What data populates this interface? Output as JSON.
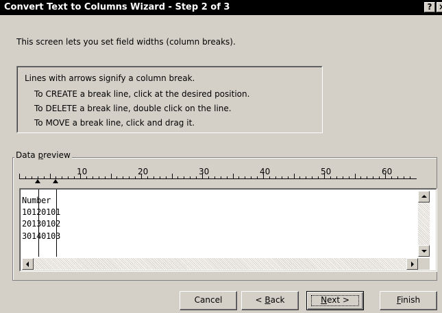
{
  "window": {
    "title": "Convert Text to Columns Wizard - Step 2 of 3",
    "help_glyph": "?",
    "close_glyph": "×"
  },
  "intro": "This screen lets you set field widths (column breaks).",
  "info": {
    "heading": "Lines with arrows signify a column break.",
    "create": "To CREATE a break line, click at the desired position.",
    "delete": "To DELETE a break line, double click on the line.",
    "move": "To MOVE a break line, click and drag it."
  },
  "preview": {
    "group_label_pre": "Data ",
    "group_label_u": "p",
    "group_label_post": "review",
    "ruler_numbers": [
      "10",
      "20",
      "30",
      "40",
      "50",
      "60"
    ],
    "rows": [
      "Number",
      "10120101",
      "20130102",
      "30140103"
    ]
  },
  "buttons": {
    "cancel": "Cancel",
    "back_pre": "< ",
    "back_u": "B",
    "back_post": "ack",
    "next_u": "N",
    "next_post": "ext >",
    "finish_u": "F",
    "finish_post": "inish"
  },
  "icons": {
    "help": "help-icon",
    "close": "close-icon",
    "scroll_up": "arrow-up-icon",
    "scroll_down": "arrow-down-icon",
    "scroll_left": "arrow-left-icon",
    "scroll_right": "arrow-right-icon",
    "break_arrow": "up-arrow-icon"
  },
  "colors": {
    "dialog_bg": "#d4d0c8",
    "title_bar": "#000000",
    "title_text": "#ffffff"
  }
}
